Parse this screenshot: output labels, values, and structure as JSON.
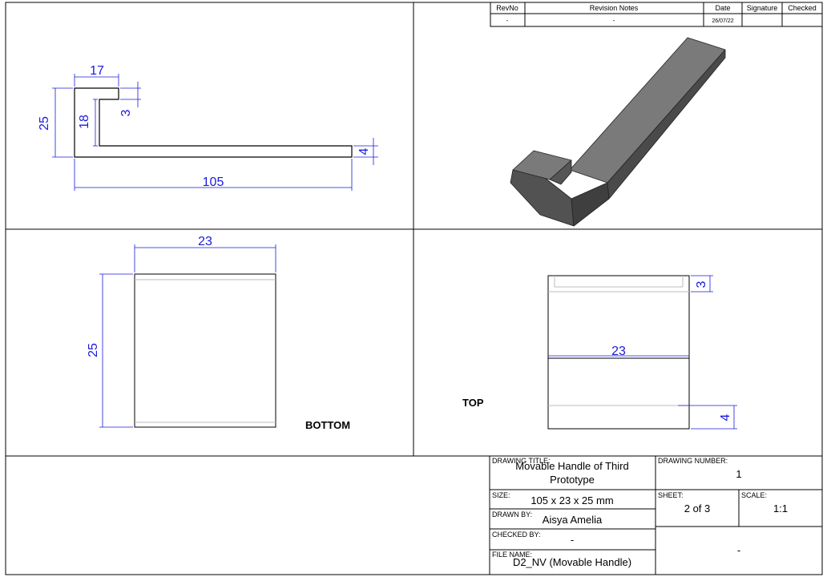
{
  "revision_table": {
    "headers": {
      "rev_no": "RevNo",
      "notes": "Revision Notes",
      "date": "Date",
      "signature": "Signature",
      "checked": "Checked"
    },
    "row": {
      "rev_no": "-",
      "notes": "-",
      "date": "26/07/22",
      "signature": "",
      "checked": ""
    }
  },
  "side_view": {
    "height": "25",
    "inner_height": "18",
    "lip_width": "17",
    "lip_thickness": "3",
    "base_thickness": "4",
    "length": "105"
  },
  "bottom_view": {
    "label": "BOTTOM",
    "width": "23",
    "height": "25"
  },
  "top_view": {
    "label": "TOP",
    "width": "23",
    "lip": "3",
    "base": "4"
  },
  "title_block": {
    "drawing_title_label": "DRAWING TITLE:",
    "drawing_title_line1": "Movable Handle of Third",
    "drawing_title_line2": "Prototype",
    "drawing_number_label": "DRAWING NUMBER:",
    "drawing_number": "1",
    "size_label": "SIZE:",
    "size": "105 x 23 x 25 mm",
    "drawn_by_label": "DRAWN BY:",
    "drawn_by": "Aisya Amelia",
    "checked_by_label": "CHECKED BY:",
    "checked_by": "-",
    "file_name_label": "FILE NAME:",
    "file_name": "D2_NV (Movable Handle)",
    "sheet_label": "SHEET:",
    "sheet": "2 of 3",
    "scale_label": "SCALE:",
    "scale": "1:1",
    "extra": "-"
  },
  "colors": {
    "dimension": "#1a1adb",
    "line": "#000000",
    "model_top": "#7a7a7a",
    "model_side": "#4a4a4a"
  }
}
